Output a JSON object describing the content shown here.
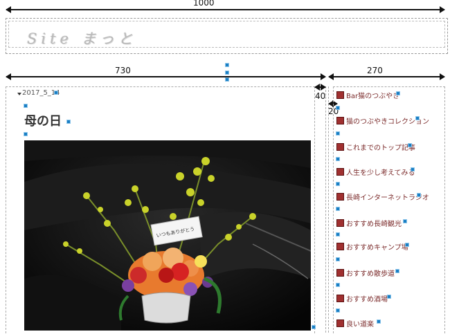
{
  "dimensions": {
    "top_width": "1000",
    "main_width": "730",
    "gap_width": "40",
    "side_width": "270",
    "inner_gap": "20"
  },
  "header": {
    "logo_text": "Site まっと"
  },
  "post": {
    "date": "2017_5_14",
    "title": "母の日",
    "card_text": "いつもありがとう"
  },
  "sidebar": {
    "items": [
      {
        "label": "Bar猫のつぶやき"
      },
      {
        "label": "猫のつぶやきコレクション"
      },
      {
        "label": "これまでのトップ記事"
      },
      {
        "label": "人生を少し考えてみる"
      },
      {
        "label": "長崎インターネットラジオ"
      },
      {
        "label": "おすすめ長崎観光"
      },
      {
        "label": "おすすめキャンプ場"
      },
      {
        "label": "おすすめ散歩道"
      },
      {
        "label": "おすすめ酒場"
      },
      {
        "label": "良い道楽"
      }
    ]
  },
  "colors": {
    "accent_marker": "#1a7fc4",
    "sidebar_text": "#7b2b2b",
    "sidebar_icon": "#a03030"
  }
}
